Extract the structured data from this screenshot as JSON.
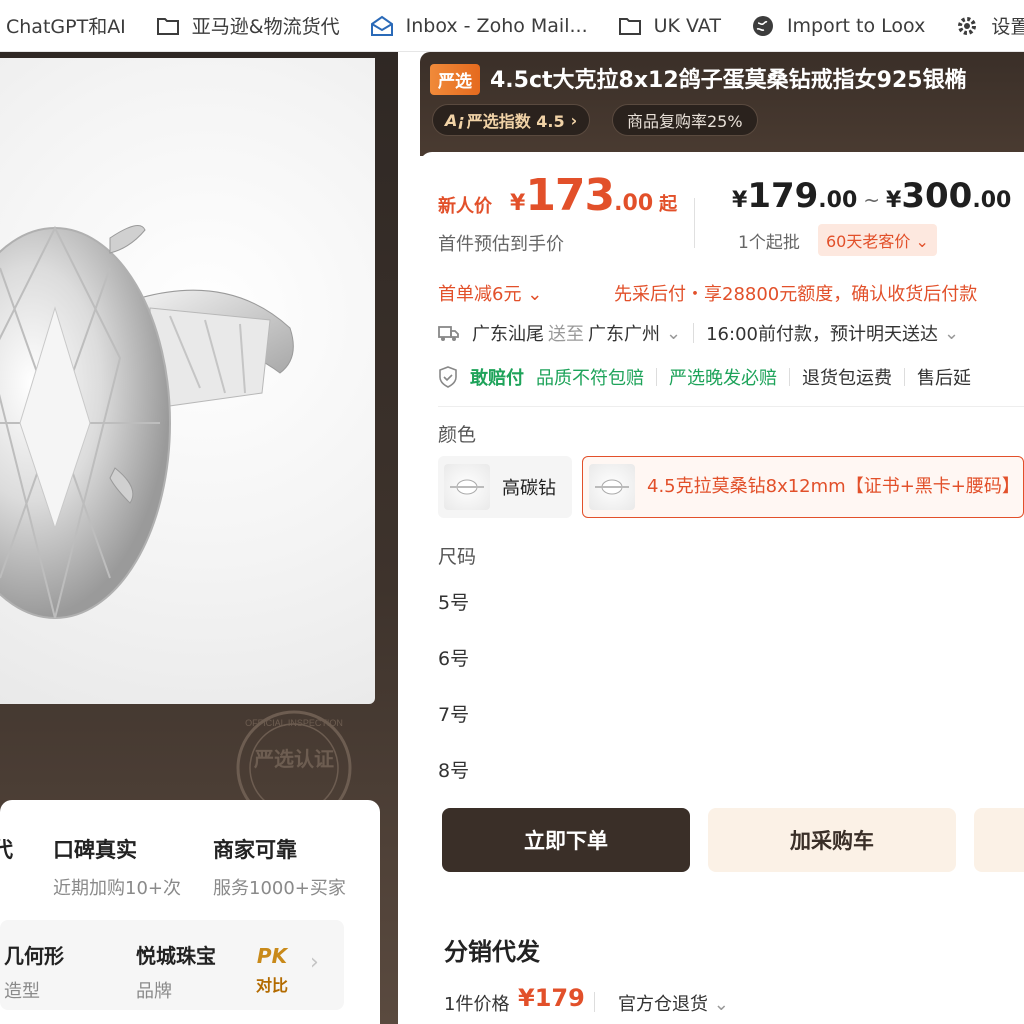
{
  "bookmarks": [
    {
      "label": "ChatGPT和AI",
      "icon": "none"
    },
    {
      "label": "亚马逊&物流货代",
      "icon": "folder-icon"
    },
    {
      "label": "Inbox - Zoho Mail...",
      "icon": "mail-icon"
    },
    {
      "label": "UK VAT",
      "icon": "folder-icon"
    },
    {
      "label": "Import to Loox",
      "icon": "globe-icon"
    },
    {
      "label": "设置",
      "icon": "gear-icon"
    }
  ],
  "badges": {
    "col0": {
      "title": "代",
      "sub": ""
    },
    "col1": {
      "title": "口碑真实",
      "sub": "近期加购10+次"
    },
    "col2": {
      "title": "商家可靠",
      "sub": "服务1000+买家"
    }
  },
  "compare": {
    "item1": {
      "title": "几何形",
      "sub": "造型"
    },
    "item2": {
      "title": "悦城珠宝",
      "sub": "品牌"
    },
    "pk_big": "PK",
    "pk_small": "对比"
  },
  "stamp": {
    "ring_text": "OFFICIAL INSPECTION",
    "center_text": "严选认证"
  },
  "header": {
    "tag": "严选",
    "title": "4.5ct大克拉8x12鸽子蛋莫桑钻戒指女925银椭",
    "ai_pill": "严选指数 4.5",
    "ai_prefix": "A¡",
    "repurchase": "商品复购率25%"
  },
  "price": {
    "new_label": "新人价",
    "currency": "¥",
    "new_int": "173",
    "new_dec": ".00",
    "new_suffix": "起",
    "est_text": "首件预估到手价",
    "range_low_int": "179",
    "range_low_dec": ".00",
    "range_sep": "~",
    "range_high_int": "300",
    "range_high_dec": ".00",
    "moq": "1个起批",
    "old_customer": "60天老客价"
  },
  "promo": {
    "first_order": "首单减6元",
    "credit": "先采后付・享28800元额度，确认收货后付款"
  },
  "shipping": {
    "from": "广东汕尾",
    "to_label": "送至",
    "to": "广东广州",
    "eta": "16:00前付款，预计明天送达"
  },
  "guarantees": {
    "pay": "敢赔付",
    "quality": "品质不符包赔",
    "late": "严选晚发必赔",
    "return_fee": "退货包运费",
    "after_sale": "售后延"
  },
  "color": {
    "label": "颜色",
    "options": [
      "高碳钻",
      "4.5克拉莫桑钻8x12mm【证书+黑卡+腰码】"
    ]
  },
  "size": {
    "label": "尺码",
    "options": [
      "5号",
      "6号",
      "7号",
      "8号"
    ]
  },
  "actions": {
    "order": "立即下单",
    "cart": "加采购车"
  },
  "distribution": {
    "title": "分销代发",
    "price_label": "1件价格",
    "price": "¥179",
    "warehouse": "官方仓退货"
  }
}
